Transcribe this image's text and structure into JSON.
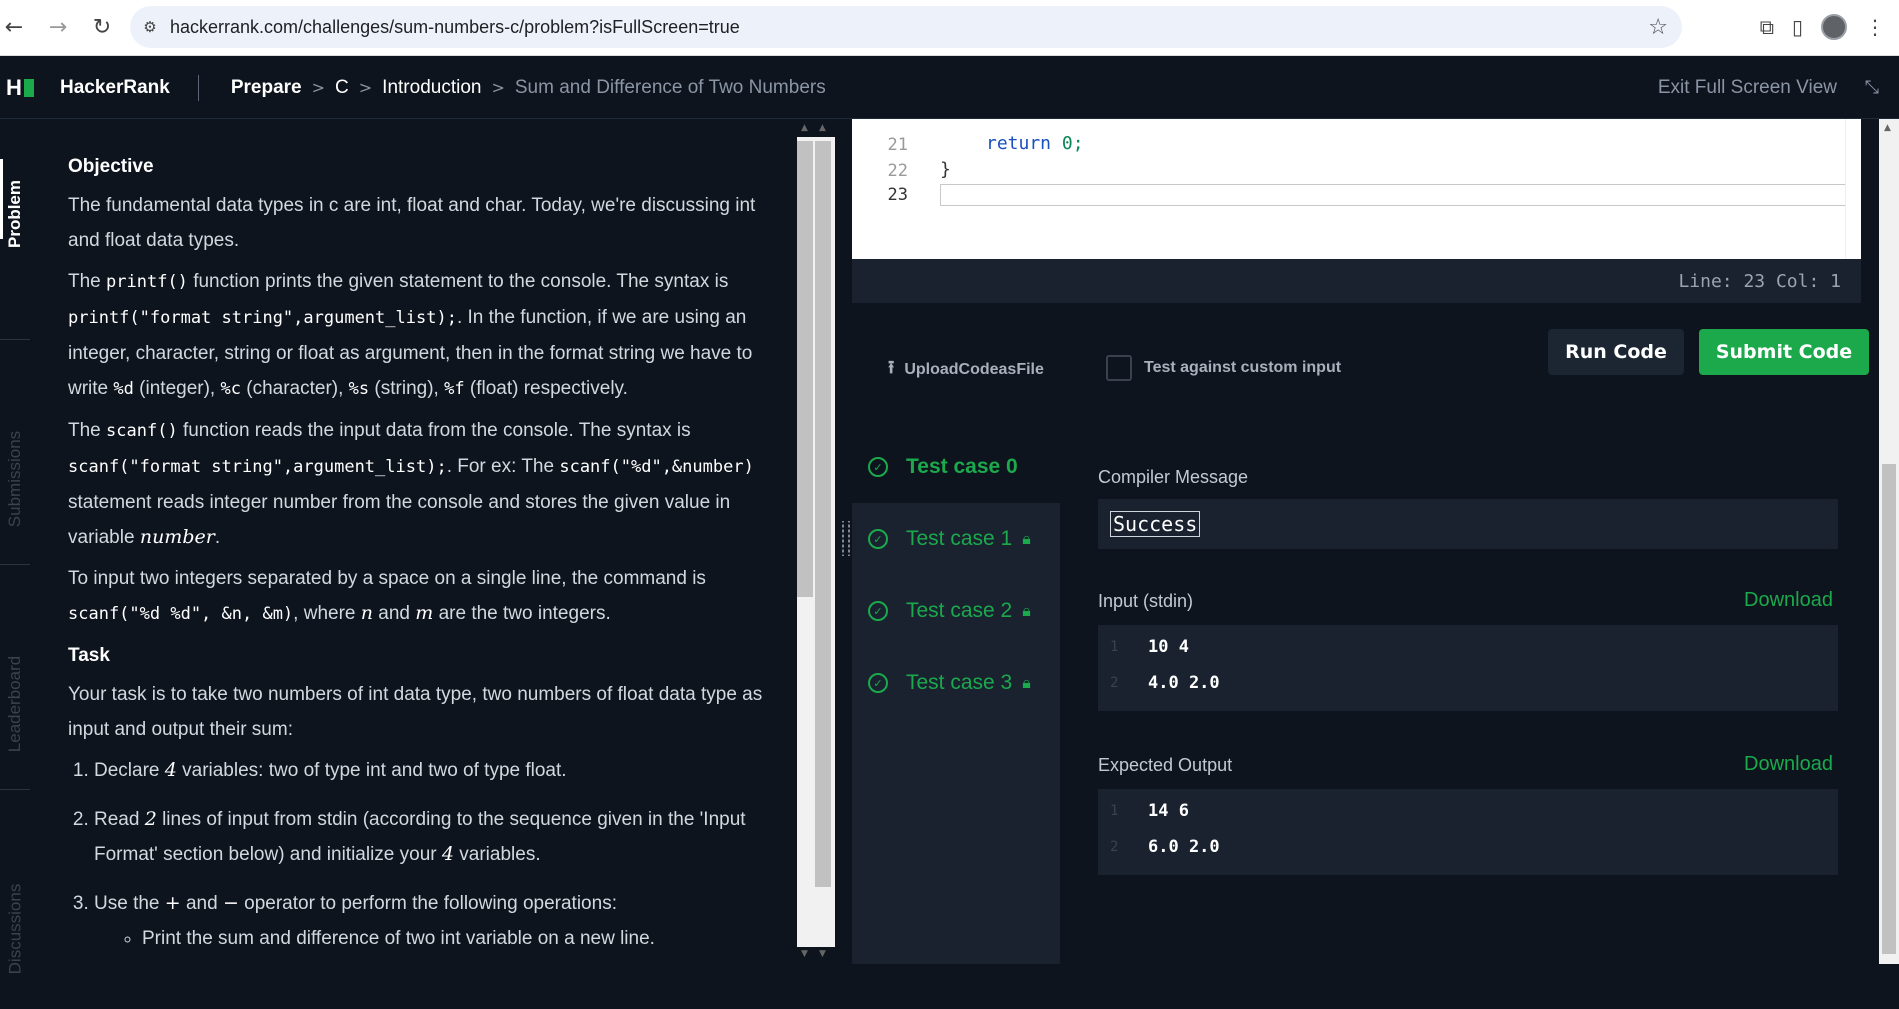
{
  "browser": {
    "url": "hackerrank.com/challenges/sum-numbers-c/problem?isFullScreen=true",
    "back_icon": "arrow-left-icon",
    "forward_icon": "arrow-right-icon",
    "reload_icon": "reload-icon"
  },
  "header": {
    "brand": "HackerRank",
    "breadcrumb": [
      "Prepare",
      "C",
      "Introduction",
      "Sum and Difference of Two Numbers"
    ],
    "exit_label": "Exit Full Screen View"
  },
  "side_tabs": [
    "Problem",
    "Submissions",
    "Leaderboard",
    "Discussions"
  ],
  "problem": {
    "objective_heading": "Objective",
    "p1": "The fundamental data types in c are int, float and char. Today, we're discussing int and float data types.",
    "p2_a": "The ",
    "p2_code1": "printf()",
    "p2_b": " function prints the given statement to the console. The syntax is ",
    "p2_code2": "printf(\"format string\",argument_list);",
    "p2_c": ". In the function, if we are using an integer, character, string or float as argument, then in the format string we have to write ",
    "p2_d": "%d",
    "p2_e": " (integer), ",
    "p2_f": "%c",
    "p2_g": " (character), ",
    "p2_h": "%s",
    "p2_i": " (string), ",
    "p2_j": "%f",
    "p2_k": " (float) respectively.",
    "p3_a": "The ",
    "p3_code1": "scanf()",
    "p3_b": " function reads the input data from the console. The syntax is ",
    "p3_code2": "scanf(\"format string\",argument_list);",
    "p3_c": ". For ex: The ",
    "p3_code3": "scanf(\"%d\",&number)",
    "p3_d": " statement reads integer number from the console and stores the given value in variable ",
    "p3_math": "number",
    "p3_e": ".",
    "p4_a": "To input two integers separated by a space on a single line, the command is ",
    "p4_code": "scanf(\"%d %d\", &n, &m)",
    "p4_b": ", where ",
    "p4_n": "n",
    "p4_c": " and ",
    "p4_m": "m",
    "p4_d": " are the two integers.",
    "task_heading": "Task",
    "task_p": "Your task is to take two numbers of int data type, two numbers of float data type as input and output their sum:",
    "li1_a": "Declare ",
    "li1_m": "4",
    "li1_b": " variables: two of type int and two of type float.",
    "li2_a": "Read ",
    "li2_m": "2",
    "li2_b": " lines of input from stdin (according to the sequence given in the 'Input Format' section below) and initialize your ",
    "li2_m2": "4",
    "li2_c": " variables.",
    "li3_a": "Use the ",
    "li3_m1": "+",
    "li3_b": " and ",
    "li3_m2": "−",
    "li3_c": " operator to perform the following operations:",
    "sub_li": "Print the sum and difference of two int variable on a new line."
  },
  "editor": {
    "lines": [
      {
        "num": "21",
        "code_kw": "return",
        "code_rest": " 0;"
      },
      {
        "num": "22",
        "code_kw": "",
        "code_rest": "}"
      },
      {
        "num": "23",
        "code_kw": "",
        "code_rest": ""
      }
    ],
    "status": "Line: 23 Col: 1"
  },
  "actions": {
    "upload_label": "UploadCodeasFile",
    "custom_input_label": "Test against custom input",
    "run_label": "Run Code",
    "submit_label": "Submit Code"
  },
  "test_cases": [
    "Test case 0",
    "Test case 1",
    "Test case 2",
    "Test case 3"
  ],
  "result": {
    "compiler_label": "Compiler Message",
    "compiler_message": "Success",
    "input_label": "Input (stdin)",
    "download_label": "Download",
    "input_lines": [
      {
        "n": "1",
        "v": "10 4"
      },
      {
        "n": "2",
        "v": "4.0 2.0"
      }
    ],
    "expected_label": "Expected Output",
    "expected_lines": [
      {
        "n": "1",
        "v": "14 6"
      },
      {
        "n": "2",
        "v": "6.0 2.0"
      }
    ]
  },
  "colors": {
    "accent": "#1ba94c",
    "bg": "#0e141e",
    "panel": "#1a2230"
  }
}
